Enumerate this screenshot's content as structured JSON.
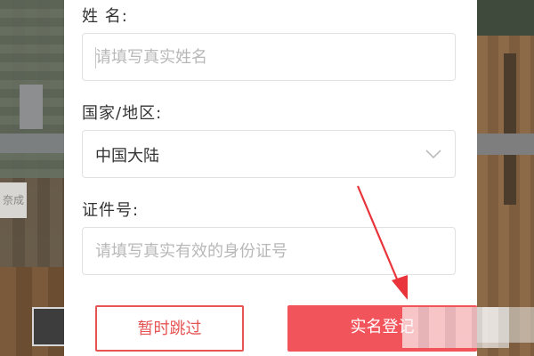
{
  "form": {
    "name": {
      "label": "姓 名:",
      "placeholder": "请填写真实姓名",
      "value": ""
    },
    "region": {
      "label": "国家/地区:",
      "selected": "中国大陆"
    },
    "id_number": {
      "label": "证件号:",
      "placeholder": "请填写真实有效的身份证号",
      "value": ""
    }
  },
  "buttons": {
    "skip_label": "暂时跳过",
    "register_label": "实名登记"
  },
  "colors": {
    "accent": "#f2545b",
    "skip_border": "#e65454",
    "annotation_arrow": "#e8343a"
  },
  "icons": {
    "dropdown": "chevron-down-icon",
    "annotation": "red-arrow-icon"
  },
  "background": {
    "left_partial_text": "奈成"
  }
}
